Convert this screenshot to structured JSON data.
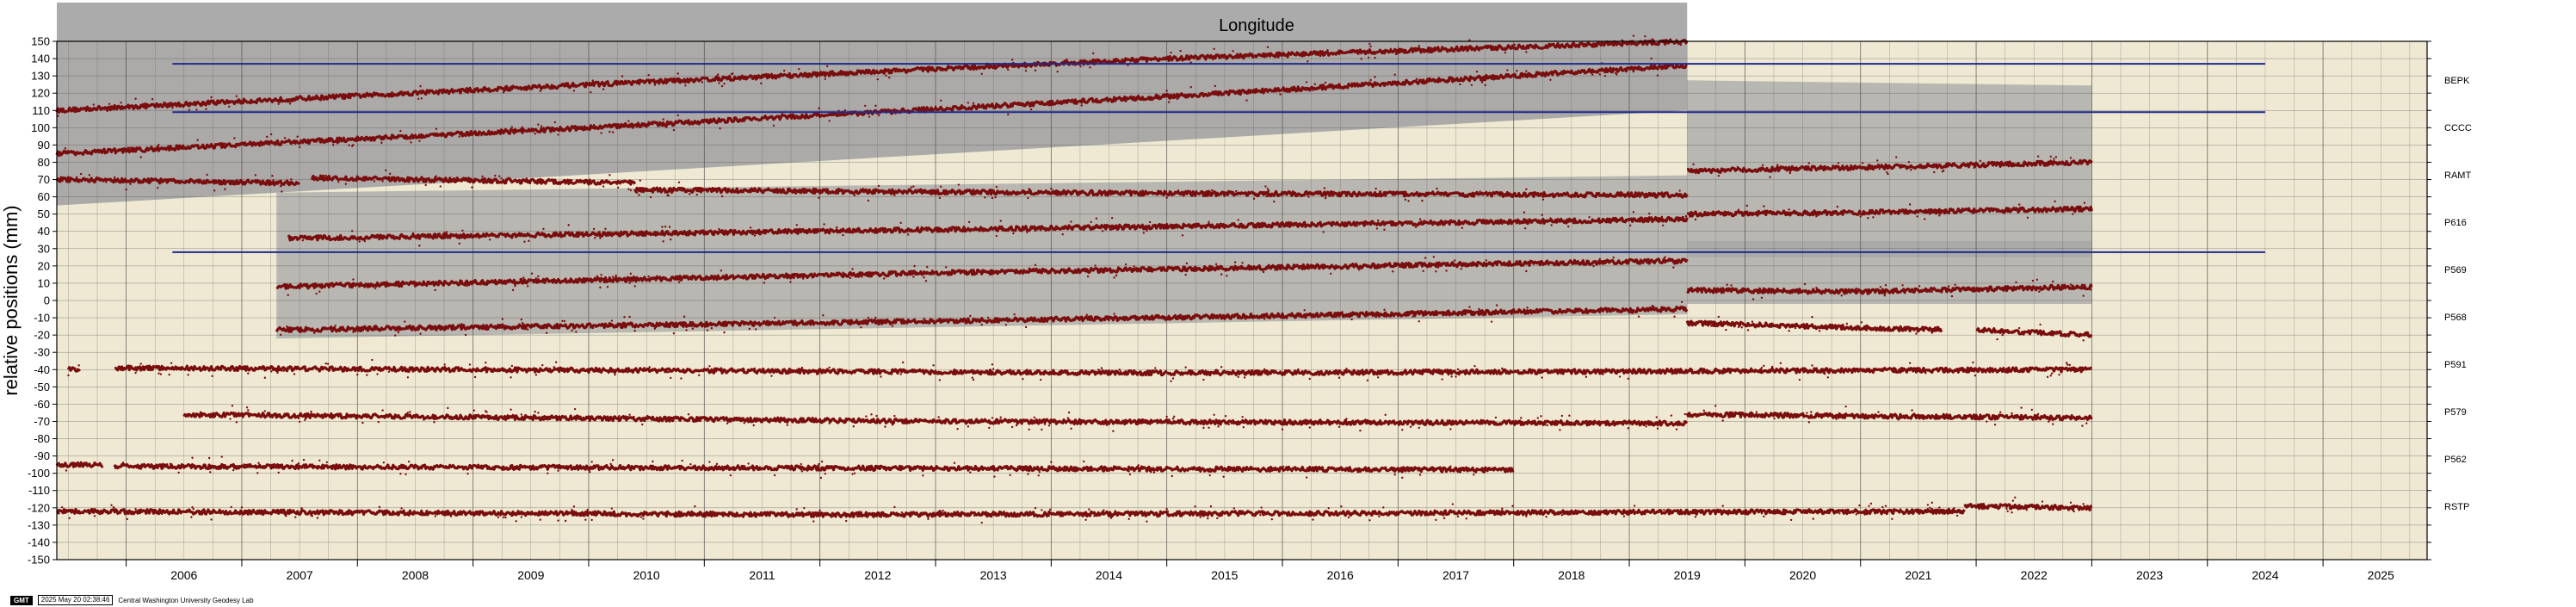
{
  "chart_data": {
    "type": "scatter",
    "title": "Longitude",
    "xlabel": "",
    "ylabel": "relative positions (mm)",
    "xlim": [
      2005.4,
      2025.9
    ],
    "ylim": [
      -150,
      150
    ],
    "grid": true,
    "x_ticks": [
      "2006",
      "2007",
      "2008",
      "2009",
      "2010",
      "2011",
      "2012",
      "2013",
      "2014",
      "2015",
      "2016",
      "2017",
      "2018",
      "2019",
      "2020",
      "2021",
      "2022",
      "2023",
      "2024",
      "2025"
    ],
    "y_ticks": [
      150,
      140,
      130,
      120,
      110,
      100,
      90,
      80,
      70,
      60,
      50,
      40,
      30,
      20,
      10,
      0,
      -10,
      -20,
      -30,
      -40,
      -50,
      -60,
      -70,
      -80,
      -90,
      -100,
      -110,
      -120,
      -130,
      -140,
      -150
    ],
    "colors": {
      "points": "#7a0d0d",
      "uncertainty": "#a6a6a6",
      "plot_bg": "#efe9d3",
      "reference_lines": "#1f2a8c",
      "grid": "#4a4a4a"
    },
    "reference_lines": [
      {
        "y": 137,
        "x_start": 2006.4,
        "x_end": 2024.5
      },
      {
        "y": 109,
        "x_start": 2006.4,
        "x_end": 2024.5
      },
      {
        "y": 28,
        "x_start": 2006.4,
        "x_end": 2024.5
      }
    ],
    "series": [
      {
        "name": "BEPK",
        "segments": [
          {
            "x": [
              2005.4,
              2010.0,
              2015.0,
              2019.5
            ],
            "y": [
              110,
              125,
              140,
              150
            ]
          }
        ]
      },
      {
        "name": "CCCC",
        "segments": [
          {
            "x": [
              2005.4,
              2010.0,
              2015.0,
              2019.5
            ],
            "y": [
              85,
              100,
              118,
              136
            ]
          }
        ]
      },
      {
        "name": "RAMT",
        "segments": [
          {
            "x": [
              2005.4,
              2007.5
            ],
            "y": [
              70,
              68
            ]
          },
          {
            "x": [
              2007.6,
              2010.4
            ],
            "y": [
              71,
              68
            ]
          },
          {
            "x": [
              2010.4,
              2015.0,
              2019.5
            ],
            "y": [
              64,
              62,
              61
            ]
          },
          {
            "x": [
              2019.5,
              2021.0,
              2023.0
            ],
            "y": [
              75,
              77,
              80
            ]
          }
        ]
      },
      {
        "name": "P616",
        "segments": [
          {
            "x": [
              2007.4,
              2013.0,
              2019.5
            ],
            "y": [
              36,
              41,
              47
            ]
          },
          {
            "x": [
              2019.5,
              2021.0,
              2023.0
            ],
            "y": [
              50,
              51,
              53
            ]
          }
        ]
      },
      {
        "name": "P569",
        "segments": [
          {
            "x": [
              2007.3,
              2013.0,
              2019.5
            ],
            "y": [
              8,
              16,
              23
            ]
          },
          {
            "x": [
              2019.5,
              2021.0,
              2023.0
            ],
            "y": [
              6,
              5,
              8
            ]
          }
        ]
      },
      {
        "name": "P568",
        "segments": [
          {
            "x": [
              2007.3,
              2013.0,
              2019.5
            ],
            "y": [
              -17,
              -12,
              -5
            ]
          },
          {
            "x": [
              2019.5,
              2021.7
            ],
            "y": [
              -13,
              -17
            ]
          },
          {
            "x": [
              2022.0,
              2023.0
            ],
            "y": [
              -17,
              -20
            ]
          }
        ]
      },
      {
        "name": "P591",
        "segments": [
          {
            "x": [
              2005.5,
              2005.6
            ],
            "y": [
              -40,
              -40
            ]
          },
          {
            "x": [
              2005.9,
              2015.0,
              2023.0
            ],
            "y": [
              -39,
              -42,
              -40
            ]
          }
        ]
      },
      {
        "name": "P579",
        "segments": [
          {
            "x": [
              2006.5,
              2013.0,
              2019.5
            ],
            "y": [
              -66,
              -70,
              -71
            ]
          },
          {
            "x": [
              2019.5,
              2023.0
            ],
            "y": [
              -66,
              -68
            ]
          }
        ]
      },
      {
        "name": "P562",
        "segments": [
          {
            "x": [
              2005.4,
              2005.8
            ],
            "y": [
              -95,
              -95
            ]
          },
          {
            "x": [
              2005.9,
              2012.0,
              2018.0
            ],
            "y": [
              -96,
              -97,
              -98
            ]
          }
        ]
      },
      {
        "name": "RSTP",
        "segments": [
          {
            "x": [
              2005.4,
              2012.0,
              2021.9
            ],
            "y": [
              -122,
              -124,
              -122
            ]
          },
          {
            "x": [
              2021.9,
              2023.0
            ],
            "y": [
              -119,
              -120
            ]
          }
        ]
      }
    ],
    "uncertainty_bands": [
      {
        "x_start": 2005.4,
        "x_end": 2019.5,
        "y_low_start": 55,
        "y_low_end": 110,
        "y_high_start": 150,
        "y_high_end": 150
      },
      {
        "x_start": 2007.3,
        "x_end": 2019.5,
        "y_low_start": -22,
        "y_low_end": -8,
        "y_high_start": 40,
        "y_high_end": 50
      },
      {
        "x_start": 2019.5,
        "x_end": 2023.0,
        "y_low_start": 25,
        "y_low_end": 25,
        "y_high_start": 105,
        "y_high_end": 102
      },
      {
        "x_start": 2019.5,
        "x_end": 2023.0,
        "y_low_start": -2,
        "y_low_end": -2,
        "y_high_start": 12,
        "y_high_end": 12
      }
    ]
  },
  "footer": {
    "logo": "GMT",
    "timestamp": "2025 May 20 02:38:46",
    "credit": "Central Washington University Geodesy Lab"
  }
}
